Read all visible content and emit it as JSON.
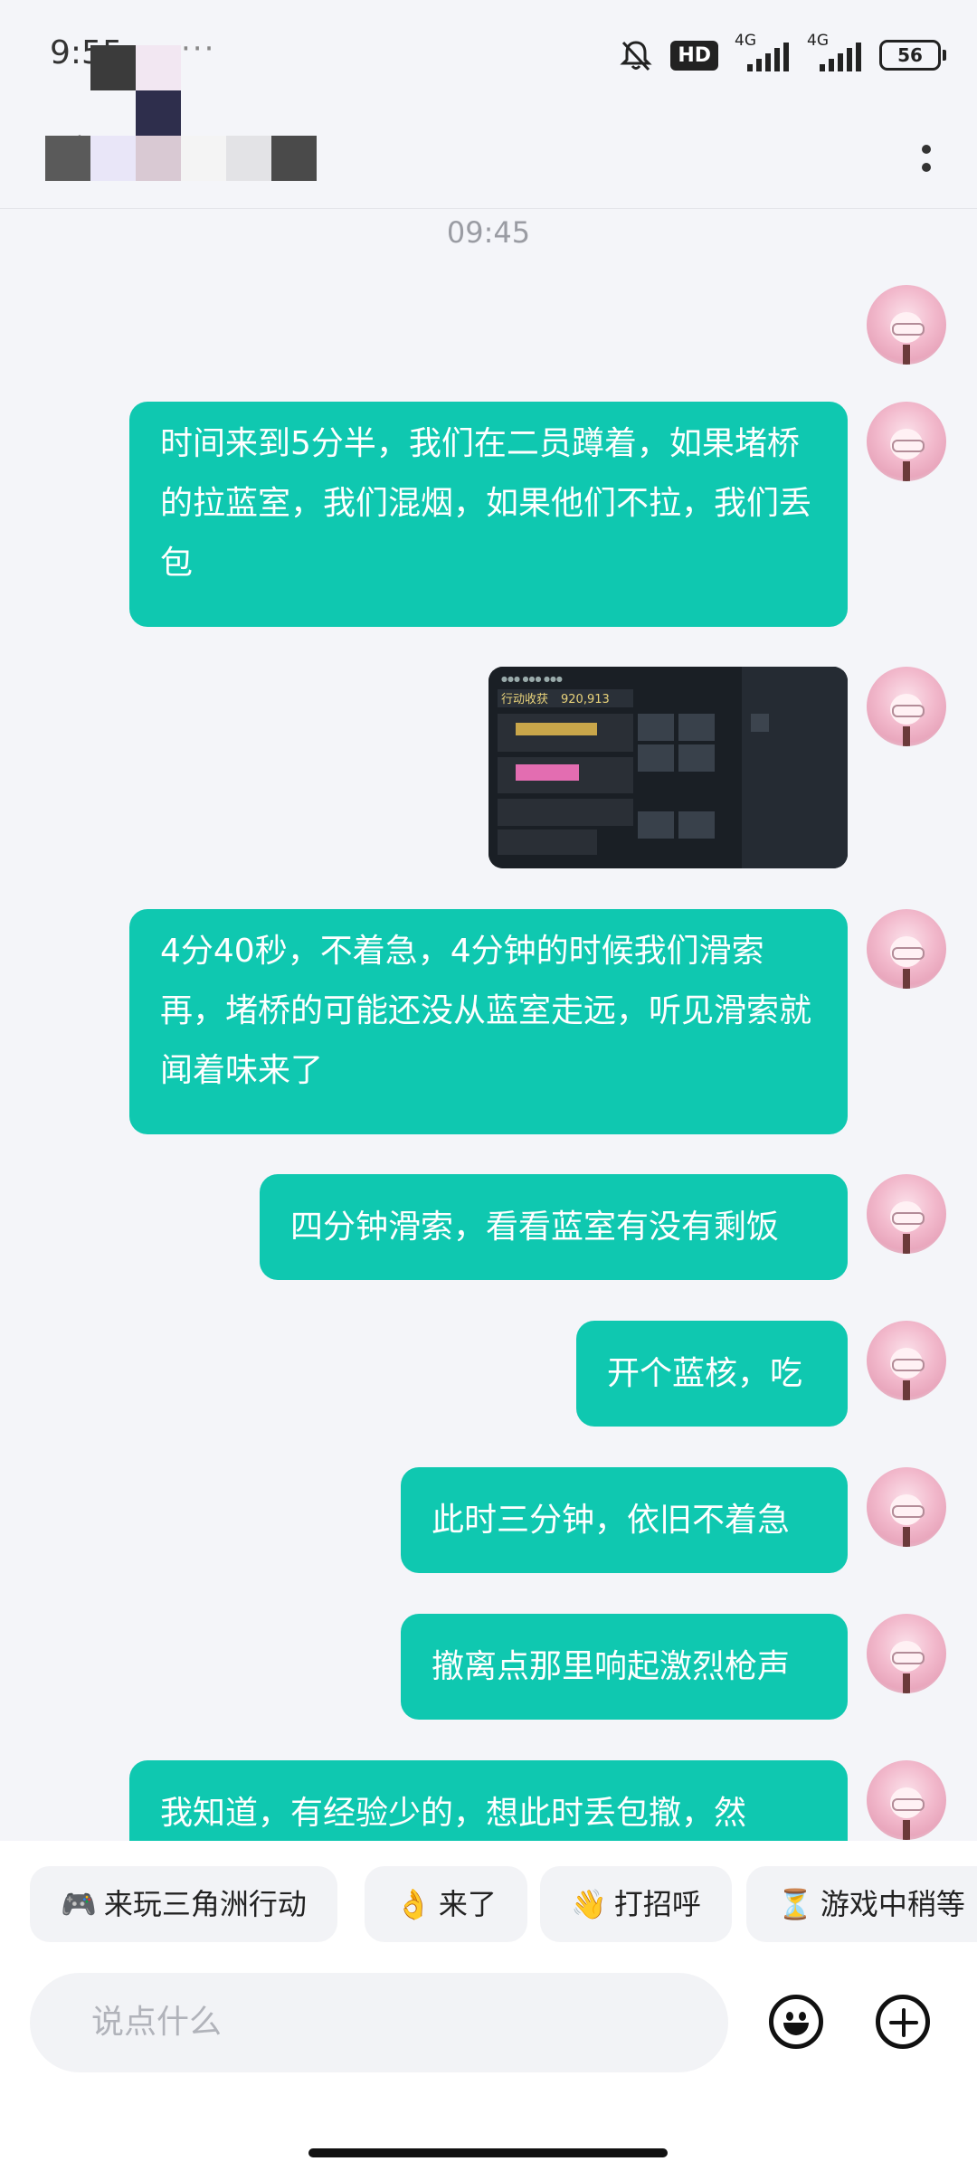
{
  "status_bar": {
    "time": "9:55",
    "dots": "···",
    "hd_badge": "HD",
    "network_1": "4G",
    "network_2": "4G",
    "battery": "56",
    "icons": [
      "mute-bell-icon",
      "hd-icon",
      "signal-icon",
      "signal-icon",
      "battery-icon"
    ]
  },
  "header": {
    "back_icon": "chevron-left-icon",
    "more_icon": "vertical-dots-icon"
  },
  "chat": {
    "timestamp": "09:45",
    "messages": [
      {
        "type": "text",
        "text": "时间来到5分半，我们在二员蹲着，如果堵桥的拉蓝室，我们混烟，如果他们不拉，我们丢包"
      },
      {
        "type": "image",
        "caption_header": "行动收获",
        "caption_value": "920,913"
      },
      {
        "type": "text",
        "text": "4分40秒，不着急，4分钟的时候我们滑索再，堵桥的可能还没从蓝室走远，听见滑索就闻着味来了"
      },
      {
        "type": "text",
        "text": "四分钟滑索，看看蓝室有没有剩饭"
      },
      {
        "type": "text",
        "text": "开个蓝核，吃"
      },
      {
        "type": "text",
        "text": "此时三分钟，依旧不着急"
      },
      {
        "type": "text",
        "text": "撤离点那里响起激烈枪声"
      },
      {
        "type": "text",
        "text": "我知道，有经验少的，想此时丢包撤，然"
      }
    ]
  },
  "quick_replies": [
    {
      "icon": "🎮",
      "label": "来玩三角洲行动"
    },
    {
      "icon": "👌",
      "label": "来了"
    },
    {
      "icon": "👋",
      "label": "打招呼"
    },
    {
      "icon": "⏳",
      "label": "游戏中稍等"
    }
  ],
  "input": {
    "placeholder": "说点什么",
    "emoji_icon": "smiley-icon",
    "plus_icon": "plus-circle-icon"
  },
  "colors": {
    "bubble": "#0fc8b0",
    "background": "#f4f5f9"
  }
}
